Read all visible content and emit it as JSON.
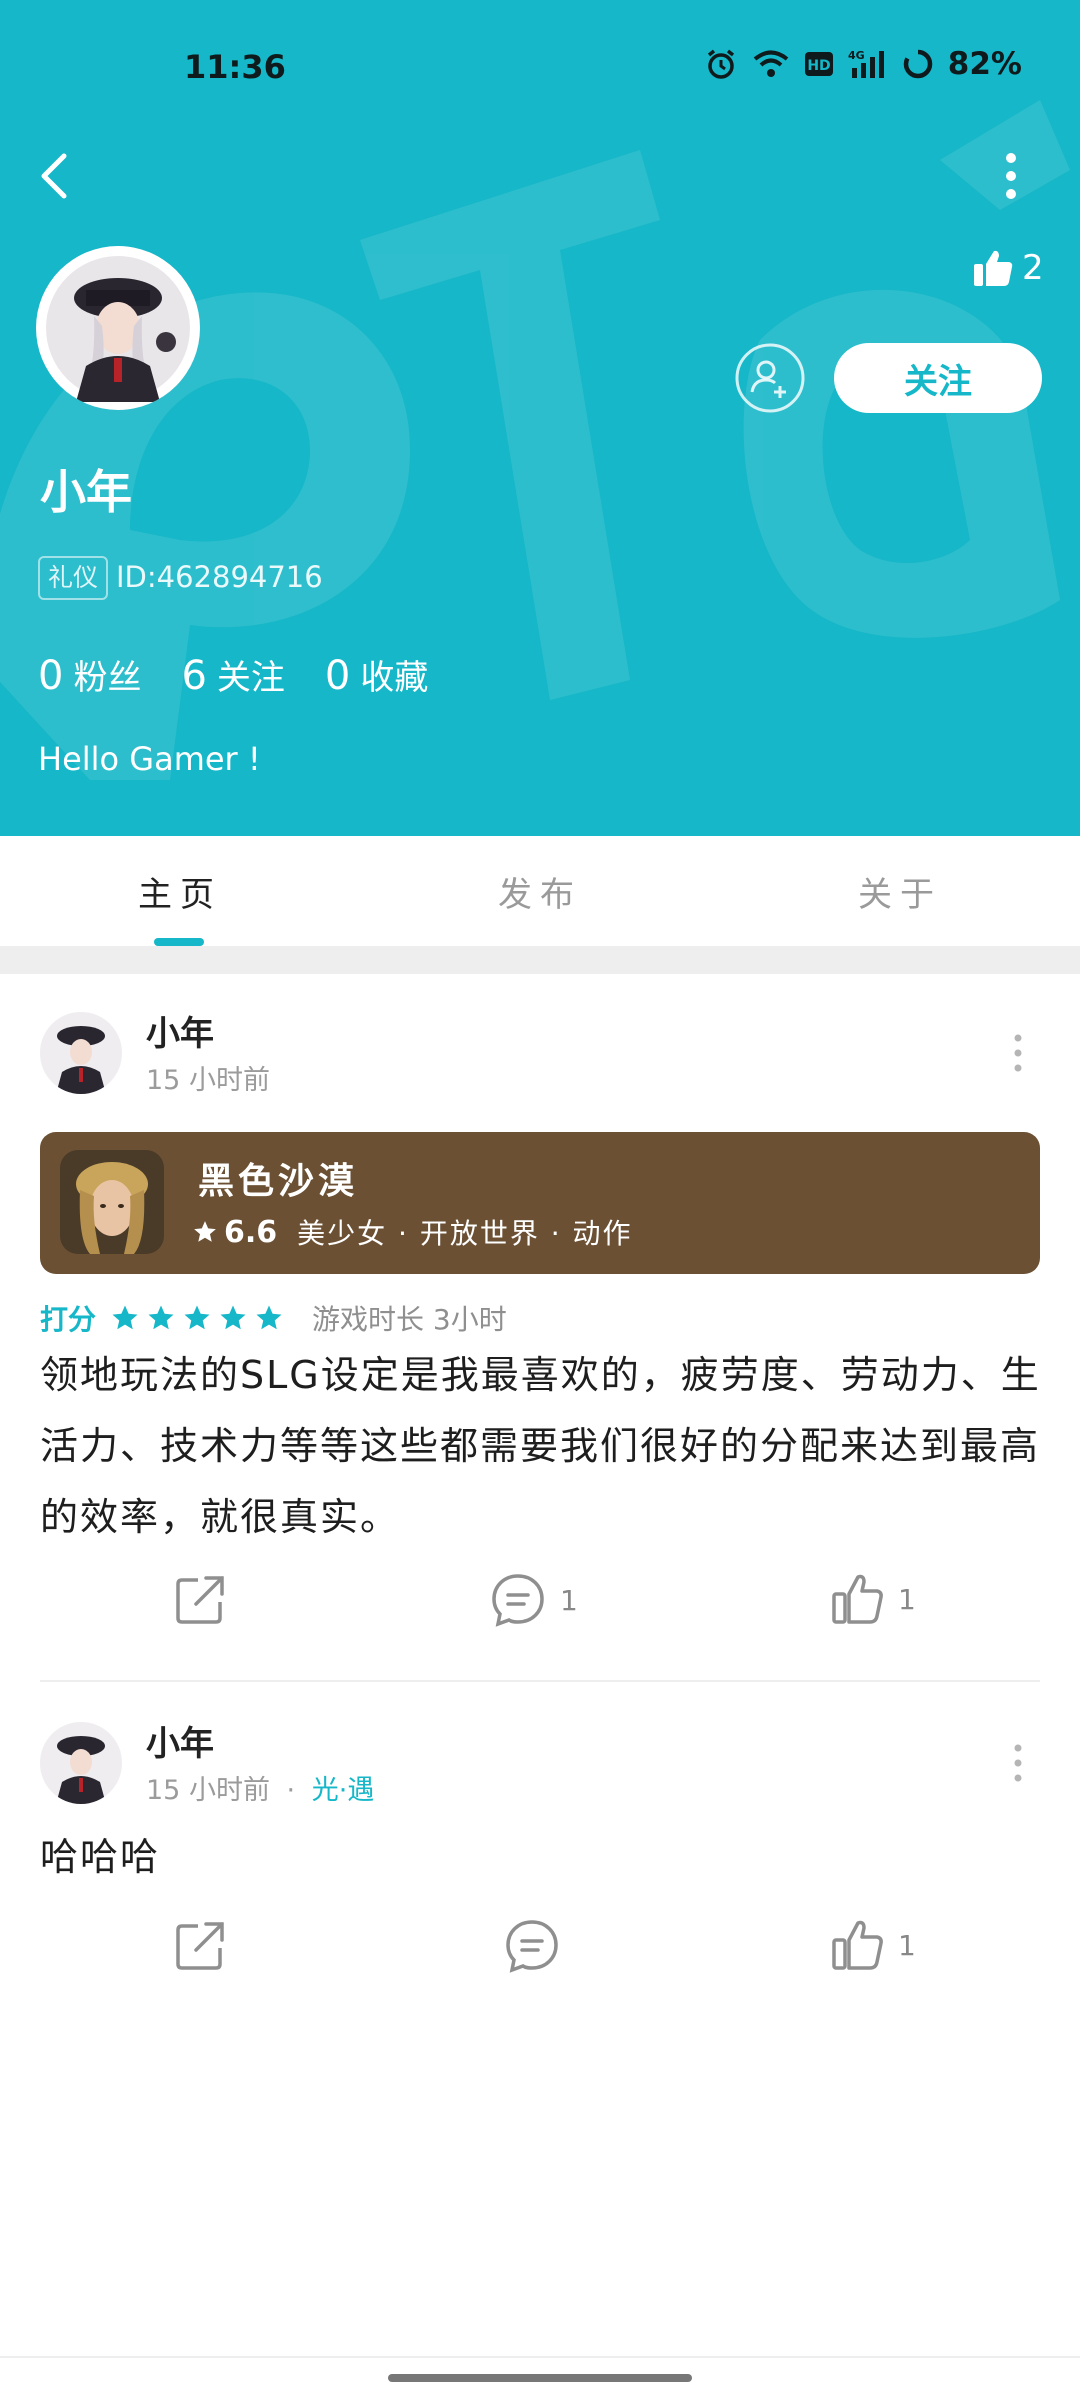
{
  "status_bar": {
    "time": "11:36",
    "battery": "82%"
  },
  "profile": {
    "name": "小年",
    "badge": "礼仪",
    "id_text": "ID:462894716",
    "likes": "2",
    "follow_label": "关注",
    "stats": [
      {
        "num": "0",
        "label": "粉丝"
      },
      {
        "num": "6",
        "label": "关注"
      },
      {
        "num": "0",
        "label": "收藏"
      }
    ],
    "bio": "Hello Gamer !"
  },
  "tabs": [
    {
      "label": "主页",
      "active": true
    },
    {
      "label": "发布",
      "active": false
    },
    {
      "label": "关于",
      "active": false
    }
  ],
  "posts": [
    {
      "author": "小年",
      "time": "15 小时前",
      "game": {
        "name": "黑色沙漠",
        "score": "6.6",
        "tags": "美少女 · 开放世界 · 动作"
      },
      "rating_label": "打分",
      "stars": 5,
      "playtime": "游戏时长 3小时",
      "text": "领地玩法的SLG设定是我最喜欢的，疲劳度、劳动力、生活力、技术力等等这些都需要我们很好的分配来达到最高的效率，就很真实。",
      "comments": "1",
      "likes": "1"
    },
    {
      "author": "小年",
      "time": "15 小时前",
      "topic_sep": "·",
      "topic": "光·遇",
      "text": "哈哈哈",
      "likes": "1"
    }
  ],
  "colors": {
    "accent": "#16b7c8",
    "game_card": "#6b5034"
  },
  "icons": [
    "back-icon",
    "more-icon",
    "thumbs-up-icon",
    "add-friend-icon",
    "star-icon",
    "share-icon",
    "comment-icon",
    "alarm-icon",
    "wifi-icon",
    "hd-icon",
    "signal-icon",
    "battery-icon"
  ]
}
